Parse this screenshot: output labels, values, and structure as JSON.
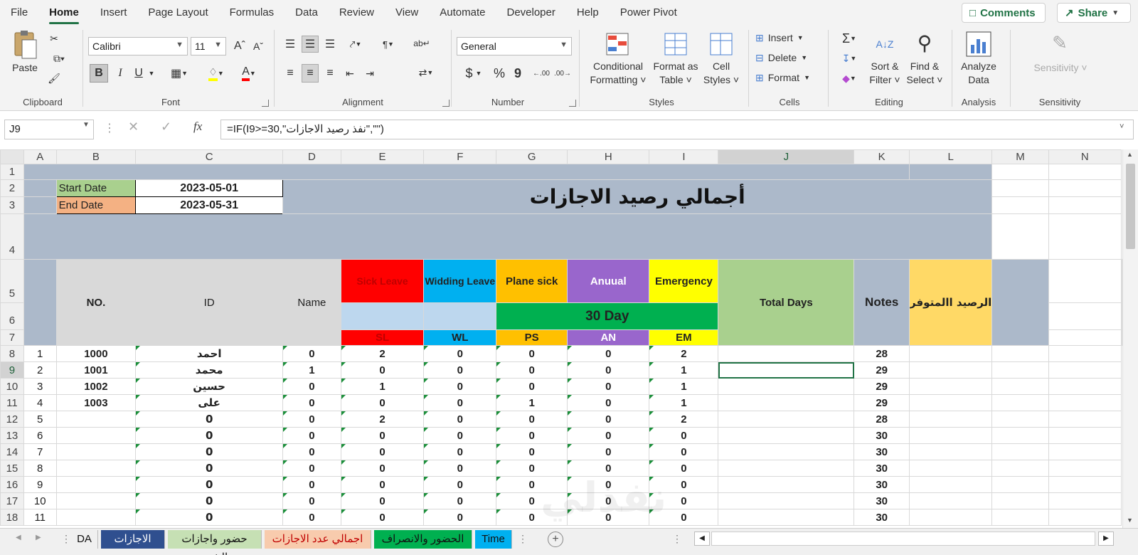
{
  "menu": {
    "tabs": [
      "File",
      "Home",
      "Insert",
      "Page Layout",
      "Formulas",
      "Data",
      "Review",
      "View",
      "Automate",
      "Developer",
      "Help",
      "Power Pivot"
    ],
    "active": "Home",
    "comments": "Comments",
    "share": "Share"
  },
  "ribbon": {
    "clipboard": {
      "paste": "Paste",
      "label": "Clipboard"
    },
    "font": {
      "name": "Calibri",
      "size": "11",
      "label": "Font",
      "bold": "B",
      "italic": "I",
      "underline": "U"
    },
    "alignment": {
      "label": "Alignment"
    },
    "number": {
      "format": "General",
      "label": "Number",
      "currency": "$",
      "percent": "%",
      "comma": "9"
    },
    "styles": {
      "conditional": [
        "Conditional",
        "Formatting"
      ],
      "format_table": [
        "Format as",
        "Table"
      ],
      "cell_styles": [
        "Cell",
        "Styles"
      ],
      "label": "Styles"
    },
    "cells": {
      "insert": "Insert",
      "delete": "Delete",
      "format": "Format",
      "label": "Cells"
    },
    "editing": {
      "sort": [
        "Sort &",
        "Filter"
      ],
      "find": [
        "Find &",
        "Select"
      ],
      "label": "Editing"
    },
    "analysis": {
      "analyze": [
        "Analyze",
        "Data"
      ],
      "label": "Analysis"
    },
    "sensitivity": {
      "button": "Sensitivity",
      "label": "Sensitivity"
    }
  },
  "formula_bar": {
    "name_box": "J9",
    "fx": "fx",
    "formula": "=IF(I9>=30,\"نفذ رصيد الاجازات\",\"\")"
  },
  "columns": [
    "A",
    "B",
    "C",
    "D",
    "E",
    "F",
    "G",
    "H",
    "I",
    "J",
    "K",
    "L",
    "M",
    "N"
  ],
  "rows": [
    "1",
    "2",
    "3",
    "4",
    "5",
    "6",
    "7",
    "8",
    "9",
    "10",
    "11",
    "12",
    "13",
    "14",
    "15",
    "16",
    "17",
    "18"
  ],
  "header_block": {
    "start_label": "Start Date",
    "start_value": "2023-05-01",
    "end_label": "End Date",
    "end_value": "2023-05-31",
    "title": "أجمالي رصيد الاجازات"
  },
  "table_headers": {
    "no": "NO.",
    "id": "ID",
    "name": "Name",
    "sick": "Sick Leave",
    "widding": "Widding Leave",
    "plane": "Plane sick",
    "anuual": "Anuual",
    "emergency": "Emergency",
    "days30": "30 Day",
    "total": "Total Days",
    "notes": "Notes",
    "balance": "الرصيد االمتوفر",
    "codes": [
      "SL",
      "WL",
      "PS",
      "AN",
      "EM"
    ]
  },
  "colors": {
    "sick": "#ff0000",
    "widding": "#00b0f0",
    "plane": "#ffc000",
    "anuual": "#9966cc",
    "emergency": "#ffff00",
    "day30": "#00b050",
    "total": "#a9d08e",
    "notes": "#acb9ca",
    "balance": "#ffd966",
    "light": "#bdd7ee"
  },
  "data_rows": [
    {
      "no": "1",
      "id": "1000",
      "name": "احمد",
      "sl": "0",
      "wl": "2",
      "ps": "0",
      "an": "0",
      "em": "0",
      "total": "2",
      "notes": "",
      "bal": "28"
    },
    {
      "no": "2",
      "id": "1001",
      "name": "محمد",
      "sl": "1",
      "wl": "0",
      "ps": "0",
      "an": "0",
      "em": "0",
      "total": "1",
      "notes": "",
      "bal": "29"
    },
    {
      "no": "3",
      "id": "1002",
      "name": "حسين",
      "sl": "0",
      "wl": "1",
      "ps": "0",
      "an": "0",
      "em": "0",
      "total": "1",
      "notes": "",
      "bal": "29"
    },
    {
      "no": "4",
      "id": "1003",
      "name": "على",
      "sl": "0",
      "wl": "0",
      "ps": "0",
      "an": "1",
      "em": "0",
      "total": "1",
      "notes": "",
      "bal": "29"
    },
    {
      "no": "5",
      "id": "",
      "name": "0",
      "sl": "0",
      "wl": "2",
      "ps": "0",
      "an": "0",
      "em": "0",
      "total": "2",
      "notes": "",
      "bal": "28"
    },
    {
      "no": "6",
      "id": "",
      "name": "0",
      "sl": "0",
      "wl": "0",
      "ps": "0",
      "an": "0",
      "em": "0",
      "total": "0",
      "notes": "",
      "bal": "30"
    },
    {
      "no": "7",
      "id": "",
      "name": "0",
      "sl": "0",
      "wl": "0",
      "ps": "0",
      "an": "0",
      "em": "0",
      "total": "0",
      "notes": "",
      "bal": "30"
    },
    {
      "no": "8",
      "id": "",
      "name": "0",
      "sl": "0",
      "wl": "0",
      "ps": "0",
      "an": "0",
      "em": "0",
      "total": "0",
      "notes": "",
      "bal": "30"
    },
    {
      "no": "9",
      "id": "",
      "name": "0",
      "sl": "0",
      "wl": "0",
      "ps": "0",
      "an": "0",
      "em": "0",
      "total": "0",
      "notes": "",
      "bal": "30"
    },
    {
      "no": "10",
      "id": "",
      "name": "0",
      "sl": "0",
      "wl": "0",
      "ps": "0",
      "an": "0",
      "em": "0",
      "total": "0",
      "notes": "",
      "bal": "30"
    },
    {
      "no": "11",
      "id": "",
      "name": "0",
      "sl": "0",
      "wl": "0",
      "ps": "0",
      "an": "0",
      "em": "0",
      "total": "0",
      "notes": "",
      "bal": "30"
    }
  ],
  "sheet_tabs": [
    {
      "label": "DA",
      "color": "#f0f0f0",
      "text": "#111"
    },
    {
      "label": "الاجازات",
      "color": "#2f4f8f",
      "text": "#fff"
    },
    {
      "label": "حضور واجازات الشهر",
      "color": "#c6e0b4",
      "text": "#111"
    },
    {
      "label": "اجمالي عدد الاجازات",
      "color": "#f8cbad",
      "text": "#c00000"
    },
    {
      "label": "الحضور والانصراف",
      "color": "#00b050",
      "text": "#111"
    },
    {
      "label": "Time",
      "color": "#00b0f0",
      "text": "#111"
    }
  ],
  "watermark": "نفذلي"
}
